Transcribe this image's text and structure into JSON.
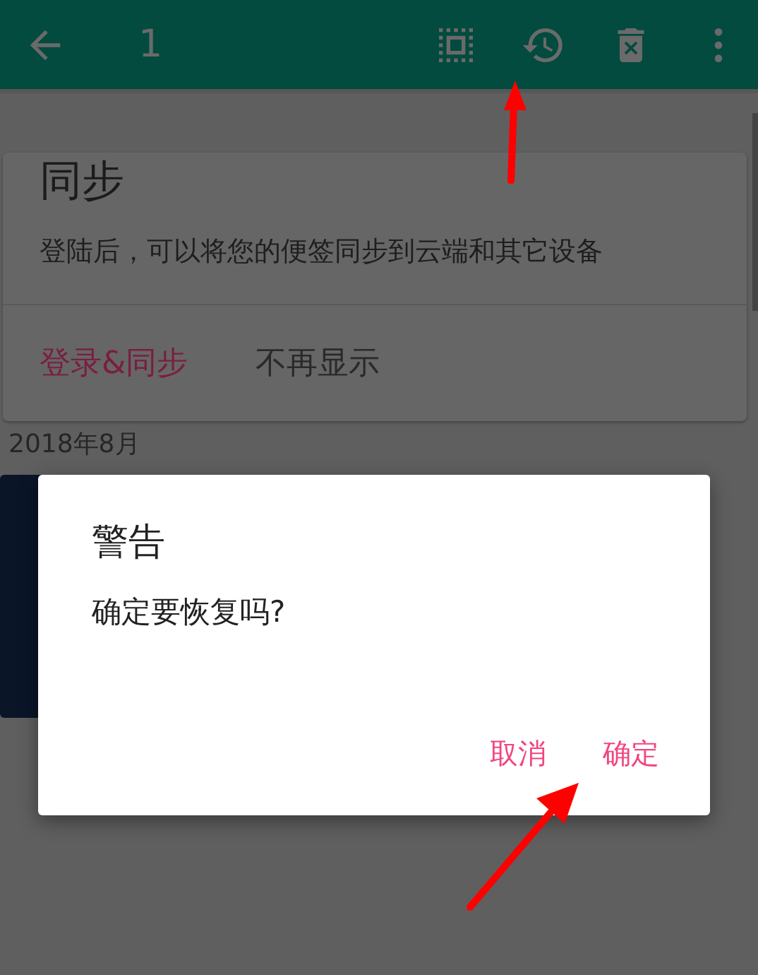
{
  "toolbar": {
    "title": "1"
  },
  "sync_card": {
    "title": "同步",
    "message": "登陆后，可以将您的便签同步到云端和其它设备",
    "actions": [
      {
        "label": "登录&同步",
        "kind": "primary"
      },
      {
        "label": "不再显示",
        "kind": "secondary"
      }
    ]
  },
  "month_heading": "2018年8月",
  "dialog": {
    "title": "警告",
    "message": "确定要恢复吗?",
    "buttons": [
      {
        "label": "取消"
      },
      {
        "label": "确定"
      }
    ]
  }
}
